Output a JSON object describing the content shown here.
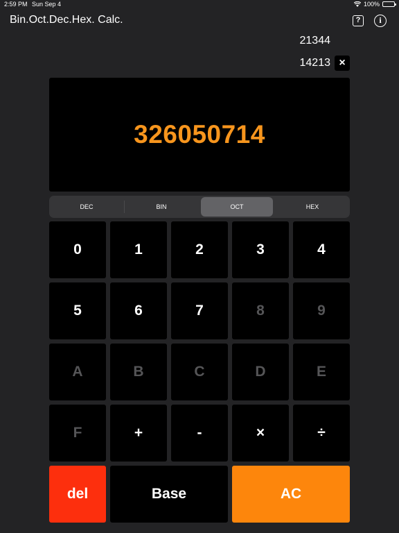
{
  "status_bar": {
    "time": "2:59 PM",
    "date": "Sun Sep 4",
    "battery": "100%"
  },
  "header": {
    "title": "Bin.Oct.Dec.Hex. Calc.",
    "help_icon": "?",
    "info_icon": "i"
  },
  "history": {
    "line1": "21344",
    "line2": "14213",
    "clear_label": "×"
  },
  "display": {
    "value": "326050714",
    "color": "#f7951d"
  },
  "base_selector": {
    "options": [
      "DEC",
      "BIN",
      "OCT",
      "HEX"
    ],
    "selected": "OCT"
  },
  "keypad": {
    "rows": [
      [
        "0",
        "1",
        "2",
        "3",
        "4"
      ],
      [
        "5",
        "6",
        "7",
        "8",
        "9"
      ],
      [
        "A",
        "B",
        "C",
        "D",
        "E"
      ],
      [
        "F",
        "+",
        "-",
        "×",
        "÷"
      ]
    ],
    "del_label": "del",
    "base_label": "Base",
    "ac_label": "AC",
    "colors": {
      "del": "#fd2f0d",
      "ac": "#fd860c"
    }
  }
}
